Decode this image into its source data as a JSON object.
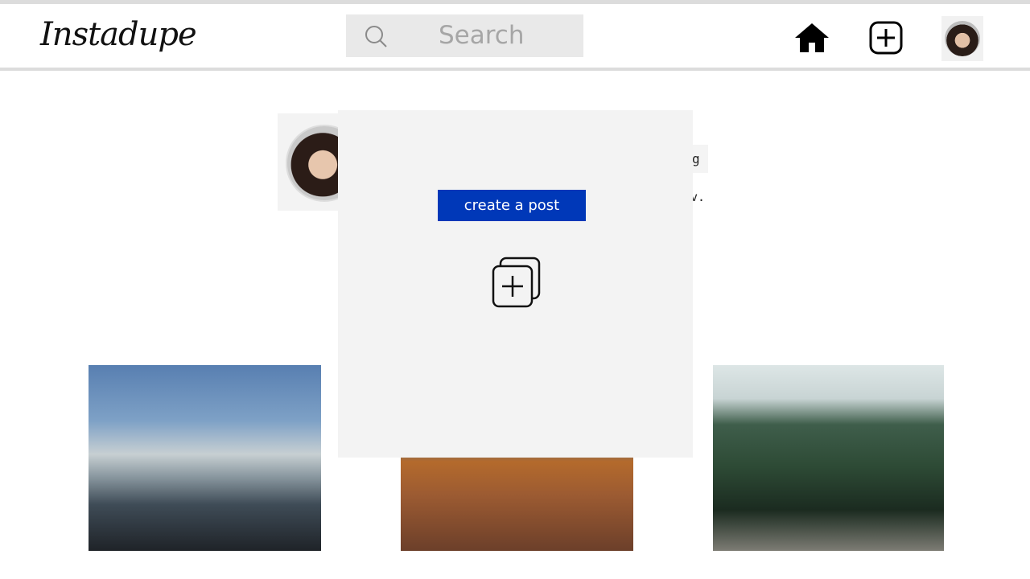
{
  "nav": {
    "logo": "Instadupe",
    "search_placeholder": "Search"
  },
  "profile": {
    "edit_partial": "g",
    "bio_partial": "v."
  },
  "modal": {
    "create_label": "create a post"
  },
  "icons": {
    "search": "search-icon",
    "home": "home-icon",
    "new_post": "add-post-icon",
    "add_media": "add-media-icon"
  }
}
